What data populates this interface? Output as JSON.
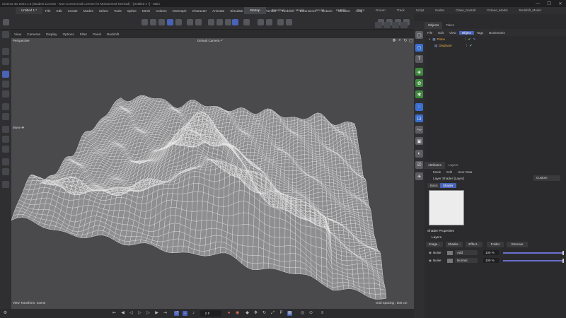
{
  "window": {
    "title": "Cinema 4D 2024.1.0 (Student License - Non-Commercial License for Mohammed Nezhad) - [Untitled 1 *] - Main",
    "controls": [
      "—",
      "❐",
      "✕"
    ]
  },
  "document_tab": "Untitled 1 *",
  "menu": [
    "File",
    "Edit",
    "Create",
    "Modes",
    "Select",
    "Tools",
    "Spline",
    "Mesh",
    "Volume",
    "MoGraph",
    "Character",
    "Animate",
    "Simulate",
    "Tracker",
    "Render",
    "Redshift",
    "Extensions",
    "Octane",
    "Window",
    "Help"
  ],
  "layouts": [
    "Startup",
    "Standard",
    "Model",
    "Sculpt",
    "UVEdit",
    "Paint",
    "Groom",
    "Track",
    "Script",
    "Nodes",
    "Claas_Nostalt",
    "Octane_Model",
    "Redshift_Model"
  ],
  "active_layout": "Startup",
  "viewport_menu": [
    "View",
    "Cameras",
    "Display",
    "Options",
    "Filter",
    "Panel",
    "Redshift"
  ],
  "viewport": {
    "name": "Perspective",
    "camera": "Default Camera •°",
    "tool_label": "Move ✥",
    "bottom_left": "View Transform: Scene",
    "grid_spacing": "Grid Spacing : 500 cm"
  },
  "timeline": {
    "frame": "0 F"
  },
  "objects_panel": {
    "tabs": [
      "Objects",
      "Takes"
    ],
    "menu": [
      "File",
      "Edit",
      "View",
      "Object",
      "Tags",
      "Bookmarks"
    ],
    "active_menu": "Object",
    "items": [
      {
        "name": "Plane"
      },
      {
        "name": "Displacer"
      }
    ]
  },
  "attributes_panel": {
    "tabs": [
      "Attributes",
      "Layers"
    ],
    "menu": [
      "Mode",
      "Edit",
      "User Data"
    ],
    "title": "Layer Shader [Layer]",
    "preset": "Custom",
    "modes": [
      "Basic",
      "Shader"
    ],
    "active_mode": "Shader",
    "section": "Shader Properties",
    "layers_label": "Layers",
    "buttons": [
      "Image...",
      "Shader...",
      "Effect...",
      "Folder",
      "Remove"
    ],
    "layers": [
      {
        "name": "Noise",
        "mode": "Add",
        "percent": "100 %",
        "value": 1.0
      },
      {
        "name": "Noise",
        "mode": "Normal",
        "percent": "100 %",
        "value": 1.0
      }
    ]
  }
}
